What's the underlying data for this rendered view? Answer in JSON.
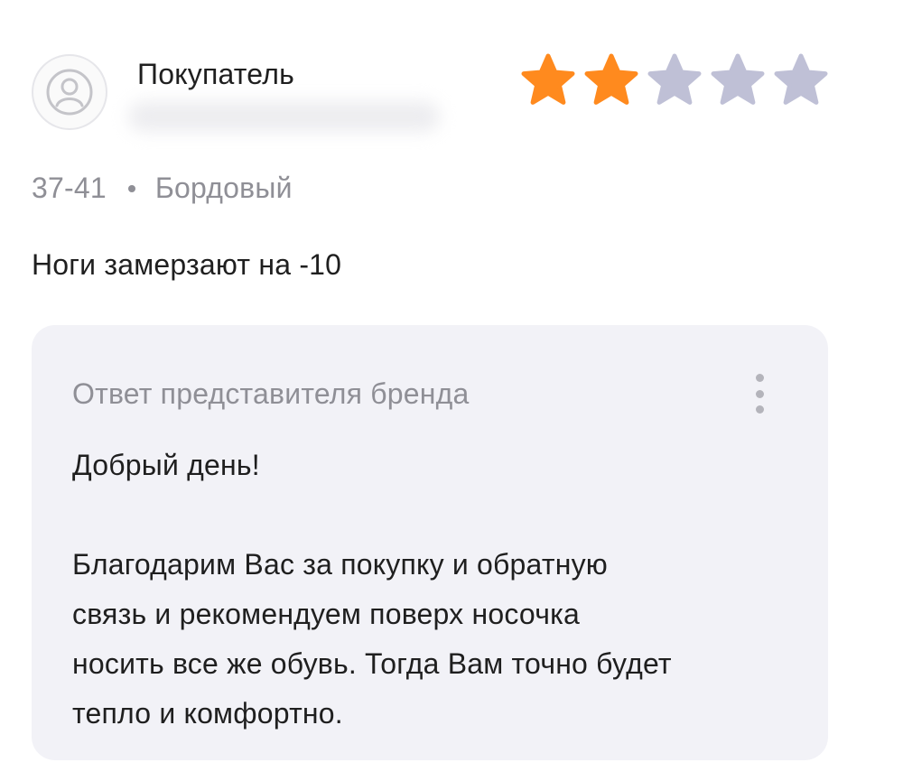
{
  "review": {
    "author": "Покупатель",
    "rating": 2,
    "max_rating": 5,
    "size": "37-41",
    "color_variant": "Бордовый",
    "text": "Ноги замерзают на -10"
  },
  "reply": {
    "title": "Ответ представителя бренда",
    "greeting": "Добрый день!",
    "lines": [
      "Благодарим Вас за покупку и обратную",
      "связь и рекомендуем поверх носочка",
      "носить все же обувь. Тогда Вам точно будет",
      "тепло и комфортно."
    ]
  },
  "icons": {
    "avatar": "user-avatar-icon",
    "star": "star-icon",
    "menu": "more-vertical-icon"
  },
  "colors": {
    "star_filled": "#FF8A1E",
    "star_empty": "#BFC0D6",
    "card_background": "#F2F2F7",
    "muted_text": "#8F8F96"
  }
}
